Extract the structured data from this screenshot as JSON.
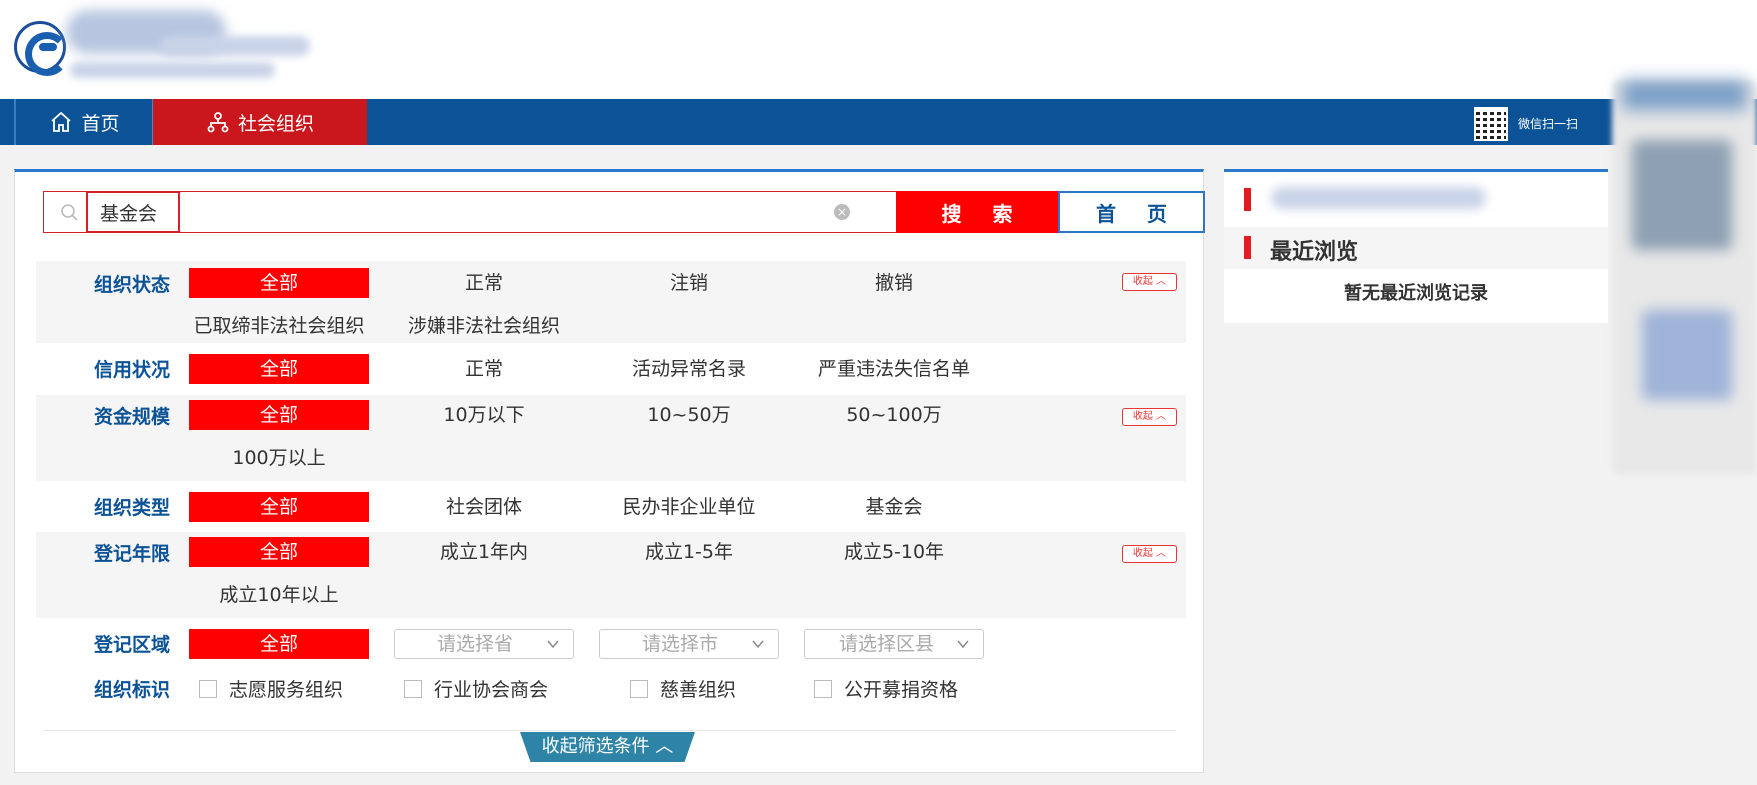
{
  "header": {
    "nav": [
      {
        "label": "首页"
      },
      {
        "label": "社会组织"
      }
    ],
    "wechat_label": "微信扫一扫"
  },
  "search": {
    "value": "基金会",
    "search_label": "搜 索",
    "home_label": "首 页"
  },
  "filters": {
    "status": {
      "label": "组织状态",
      "options": [
        "全部",
        "正常",
        "注销",
        "撤销",
        "已取缔非法社会组织",
        "涉嫌非法社会组织"
      ],
      "collapse": "收起"
    },
    "credit": {
      "label": "信用状况",
      "options": [
        "全部",
        "正常",
        "活动异常名录",
        "严重违法失信名单"
      ]
    },
    "capital": {
      "label": "资金规模",
      "options": [
        "全部",
        "10万以下",
        "10~50万",
        "50~100万",
        "100万以上"
      ],
      "collapse": "收起"
    },
    "type": {
      "label": "组织类型",
      "options": [
        "全部",
        "社会团体",
        "民办非企业单位",
        "基金会"
      ]
    },
    "years": {
      "label": "登记年限",
      "options": [
        "全部",
        "成立1年内",
        "成立1-5年",
        "成立5-10年",
        "成立10年以上"
      ],
      "collapse": "收起"
    },
    "region": {
      "label": "登记区域",
      "all": "全部",
      "province_placeholder": "请选择省",
      "city_placeholder": "请选择市",
      "district_placeholder": "请选择区县"
    },
    "marks": {
      "label": "组织标识",
      "options": [
        "志愿服务组织",
        "行业协会商会",
        "慈善组织",
        "公开募捐资格"
      ]
    },
    "collapse_all": "收起筛选条件"
  },
  "sidebar": {
    "recent_title": "最近浏览",
    "recent_empty": "暂无最近浏览记录"
  },
  "colors": {
    "nav_blue": "#0b5396",
    "accent_red": "#ff0000",
    "active_nav": "#c9171d"
  }
}
